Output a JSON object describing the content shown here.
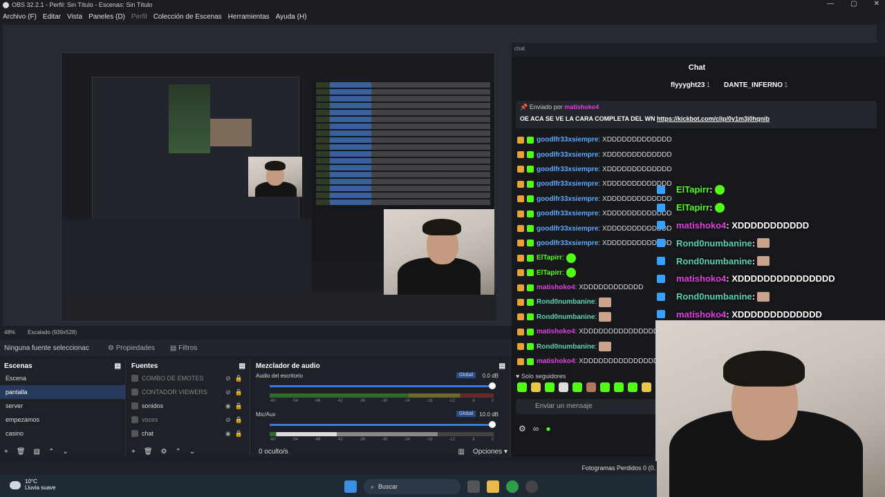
{
  "window": {
    "title": "OBS 32.2.1 - Perfil: Sin Título - Escenas: Sin Título",
    "controls": [
      "—",
      "▢",
      "✕"
    ]
  },
  "menu": [
    "Archivo (F)",
    "Editar",
    "Vista",
    "Paneles (D)",
    "Perfil",
    "Colección de Escenas",
    "Herramientas",
    "Ayuda (H)"
  ],
  "preview": {
    "zoom": "48%",
    "scale": "Escalado (939x528)"
  },
  "source_toolbar": {
    "no_source": "Ninguna fuente seleccionac",
    "properties": "Propiedades",
    "filters": "Filtros"
  },
  "scenes": {
    "title": "Escenas",
    "items": [
      "Escena",
      "pantalla",
      "server",
      "empezamos",
      "casino"
    ],
    "selected": 1
  },
  "sources": {
    "title": "Fuentes",
    "items": [
      {
        "name": "COMBO DE EMOTES",
        "visible": false
      },
      {
        "name": "CONTADOR VIEWERS",
        "visible": false
      },
      {
        "name": "sonidos",
        "visible": true
      },
      {
        "name": "voces",
        "visible": false
      },
      {
        "name": "chat",
        "visible": true
      }
    ]
  },
  "mixer": {
    "title": "Mezclador de audio",
    "channels": [
      {
        "name": "Audio del escritorio",
        "global": "Global",
        "db": "0.0 dB"
      },
      {
        "name": "Mic/Aux",
        "global": "Global",
        "db": "10.0 dB"
      }
    ],
    "ticks": [
      "-60",
      "-54",
      "-48",
      "-42",
      "-36",
      "-30",
      "-24",
      "-18",
      "-12",
      "-6",
      "0"
    ],
    "hidden": "0 oculto/s",
    "options": "Opciones"
  },
  "chat": {
    "window_label": "chat",
    "title": "Chat",
    "gifters": [
      {
        "name": "flyyyght23",
        "count": "1"
      },
      {
        "name": "DANTE_INFERNO",
        "count": "1"
      }
    ],
    "pinned": {
      "sent_by": "Enviado por",
      "user": "matishoko4",
      "message": "OE ACA SE VE LA CARA COMPLETA DEL WN ",
      "link": "https://kickbot.com/clip/0y1m3j0hqnib"
    },
    "messages": [
      {
        "user": "goodlfr33xsiempre",
        "text": ": XDDDDDDDDDDDDD",
        "cls": "u1"
      },
      {
        "user": "goodlfr33xsiempre",
        "text": ": XDDDDDDDDDDDDD",
        "cls": "u1"
      },
      {
        "user": "goodlfr33xsiempre",
        "text": ": XDDDDDDDDDDDDD",
        "cls": "u1"
      },
      {
        "user": "goodlfr33xsiempre",
        "text": ": XDDDDDDDDDDDDD",
        "cls": "u1"
      },
      {
        "user": "goodlfr33xsiempre",
        "text": ": XDDDDDDDDDDDDD",
        "cls": "u1"
      },
      {
        "user": "goodlfr33xsiempre",
        "text": ": XDDDDDDDDDDDDD",
        "cls": "u1"
      },
      {
        "user": "goodlfr33xsiempre",
        "text": ": XDDDDDDDDDDDDD",
        "cls": "u1"
      },
      {
        "user": "goodlfr33xsiempre",
        "text": ": XDDDDDDDDDDDDD",
        "cls": "u1"
      },
      {
        "user": "ElTapirr",
        "text": ":",
        "cls": "u2",
        "emote": "green"
      },
      {
        "user": "ElTapirr",
        "text": ":",
        "cls": "u2",
        "emote": "green"
      },
      {
        "user": "matishoko4",
        "text": ": XDDDDDDDDDDDD",
        "cls": "u3"
      },
      {
        "user": "Rond0numbanine",
        "text": ":",
        "cls": "u4",
        "emote": "face"
      },
      {
        "user": "Rond0numbanine",
        "text": ":",
        "cls": "u4",
        "emote": "face"
      },
      {
        "user": "matishoko4",
        "text": ": XDDDDDDDDDDDDDDD",
        "cls": "u3"
      },
      {
        "user": "Rond0numbanine",
        "text": ":",
        "cls": "u4",
        "emote": "face"
      },
      {
        "user": "matishoko4",
        "text": ": XDDDDDDDDDDDDDDD",
        "cls": "u3"
      }
    ],
    "only_followers": "Solo seguidores",
    "send_placeholder": "Enviar un mensaje"
  },
  "overlay": [
    {
      "user": "ElTapirr",
      "text": ":",
      "cls": "u2"
    },
    {
      "user": "ElTapirr",
      "text": ":",
      "cls": "u2"
    },
    {
      "user": "matishoko4",
      "text": ": XDDDDDDDDDDD",
      "cls": "u3"
    },
    {
      "user": "Rond0numbanine",
      "text": ":",
      "cls": "u4"
    },
    {
      "user": "Rond0numbanine",
      "text": ":",
      "cls": "u4"
    },
    {
      "user": "matishoko4",
      "text": ": XDDDDDDDDDDDDDDD",
      "cls": "u3"
    },
    {
      "user": "Rond0numbanine",
      "text": ":",
      "cls": "u4"
    },
    {
      "user": "matishoko4",
      "text": ": XDDDDDDDDDDDDD",
      "cls": "u3"
    }
  ],
  "status": {
    "frames": "Fotogramas Perdidos 0 (0."
  },
  "taskbar": {
    "temp": "10°C",
    "weather": "Lluvia suave",
    "search": "Buscar"
  }
}
